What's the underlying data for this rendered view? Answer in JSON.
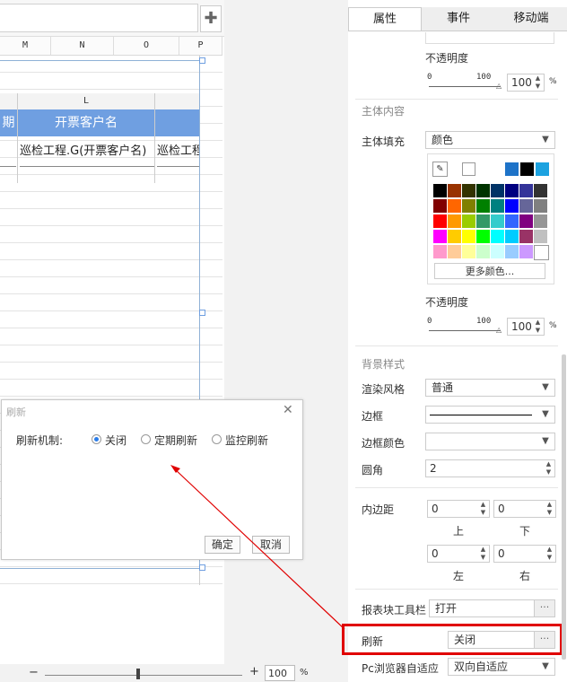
{
  "spreadsheet": {
    "column_headers": [
      "M",
      "N",
      "O",
      "P"
    ],
    "block_column_header": "L",
    "header_cells": [
      "期",
      "开票客户名"
    ],
    "data_cells": [
      "巡检工程.G(开票客户名)",
      "巡检工程"
    ]
  },
  "property_panel": {
    "tabs": [
      "属性",
      "事件",
      "移动端"
    ],
    "opacity_label": "不透明度",
    "slider_min": "0",
    "slider_max": "100",
    "opacity_value_1": "100",
    "opacity_value_2": "100",
    "percent": "%",
    "main_section": "主体内容",
    "fill_label": "主体填充",
    "fill_value": "颜色",
    "more_colors": "更多颜色...",
    "bg_section": "背景样式",
    "render_label": "渲染风格",
    "render_value": "普通",
    "border_label": "边框",
    "border_color_label": "边框颜色",
    "radius_label": "圆角",
    "radius_value": "2",
    "padding_label": "内边距",
    "padding_top": "0",
    "padding_bottom": "0",
    "padding_left": "0",
    "padding_right": "0",
    "top_label": "上",
    "bottom_label": "下",
    "left_label": "左",
    "right_label": "右",
    "toolbar_label": "报表块工具栏",
    "toolbar_value": "打开",
    "refresh_label": "刷新",
    "refresh_value": "关闭",
    "adapt_label": "Pc浏览器自适应",
    "adapt_value": "双向自适应",
    "dots": "···"
  },
  "palette_top": [
    "#1e73c8",
    "#000000",
    "#1ca2e0"
  ],
  "palette_rows": [
    [
      "#000000",
      "#993300",
      "#333300",
      "#003300",
      "#003366",
      "#000080",
      "#333399",
      "#333333"
    ],
    [
      "#800000",
      "#ff6600",
      "#808000",
      "#008000",
      "#008080",
      "#0000ff",
      "#666699",
      "#808080"
    ],
    [
      "#ff0000",
      "#ff9900",
      "#99cc00",
      "#339966",
      "#33cccc",
      "#3366ff",
      "#800080",
      "#969696"
    ],
    [
      "#ff00ff",
      "#ffcc00",
      "#ffff00",
      "#00ff00",
      "#00ffff",
      "#00ccff",
      "#993366",
      "#c0c0c0"
    ],
    [
      "#ff99cc",
      "#ffcc99",
      "#ffff99",
      "#ccffcc",
      "#ccffff",
      "#99ccff",
      "#cc99ff",
      "#ffffff"
    ]
  ],
  "dialog": {
    "title": "刷新",
    "mechanism_label": "刷新机制:",
    "options": [
      "关闭",
      "定期刷新",
      "监控刷新"
    ],
    "confirm": "确定",
    "cancel": "取消"
  },
  "bottom": {
    "zoom_value": "100",
    "percent": "%",
    "minus": "−",
    "plus": "+"
  },
  "colors": {
    "header_blue": "#6f9fe1",
    "highlight_red": "#e00000",
    "accent_blue": "#2b7de9"
  }
}
